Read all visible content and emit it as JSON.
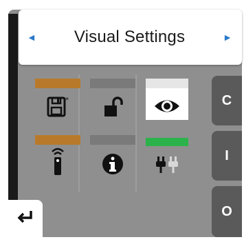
{
  "header": {
    "title": "Visual Settings",
    "prev_arrow": "◄",
    "next_arrow": "►",
    "arrow_color": "#2a78c8"
  },
  "tiles": [
    {
      "name": "save",
      "icon": "floppy-save-icon",
      "bar_color": "#b87a2a",
      "selected": false
    },
    {
      "name": "lock",
      "icon": "unlock-icon",
      "bar_color": "#7a7a7a",
      "selected": false
    },
    {
      "name": "visual",
      "icon": "eye-icon",
      "bar_color": "#e6e6e6",
      "selected": true
    },
    {
      "name": "remote",
      "icon": "remote-control-icon",
      "bar_color": "#b87a2a",
      "selected": false
    },
    {
      "name": "info",
      "icon": "info-icon",
      "bar_color": "#7a7a7a",
      "selected": false
    },
    {
      "name": "power",
      "icon": "plug-icon",
      "bar_color": "#2bb24a",
      "selected": false
    }
  ],
  "side_buttons": {
    "c_label": "C",
    "i_label": "I",
    "o_label": "O",
    "color": "#5a5a5a"
  },
  "back": {
    "icon": "return-arrow-icon"
  },
  "colors": {
    "screen_bg": "#8f8f8f",
    "header_bg": "#ffffff"
  }
}
